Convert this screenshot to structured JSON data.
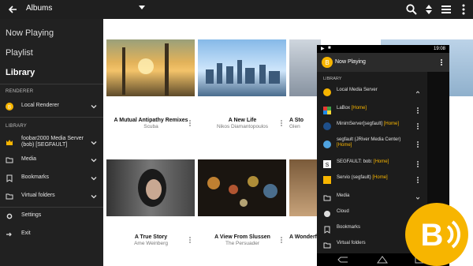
{
  "appbar": {
    "title": "Albums"
  },
  "drawer": {
    "nav": [
      "Now Playing",
      "Playlist",
      "Library"
    ],
    "renderer_section": "RENDERER",
    "renderer": "Local Renderer",
    "library_section": "LIBRARY",
    "library_items": [
      {
        "label1": "foobar2000 Media Server",
        "label2": "(bob) [SEGFAULT]"
      },
      {
        "label1": "Media",
        "label2": ""
      },
      {
        "label1": "Bookmarks",
        "label2": ""
      },
      {
        "label1": "Virtual folders",
        "label2": ""
      }
    ],
    "settings": "Settings",
    "exit": "Exit"
  },
  "albums": [
    {
      "title": "A Mutual Antipathy Remixes",
      "artist": "Scuba"
    },
    {
      "title": "A New Life",
      "artist": "Nikos Diamantopoulos"
    },
    {
      "title": "A Sto",
      "artist": "Glen"
    },
    {
      "title": "A True Story",
      "artist": "Ame Weinberg"
    },
    {
      "title": "A View From Slussen",
      "artist": "The Persuader"
    },
    {
      "title": "A Wonderfu",
      "artist": ""
    }
  ],
  "phone": {
    "time": "19:08",
    "title": "Now Playing",
    "library_section": "LIBRARY",
    "local_server": "Local Media Server",
    "servers": [
      {
        "name": "LaBox ",
        "tag": "[Home]"
      },
      {
        "name": "MinimServer[segfault] ",
        "tag": "[Home]"
      },
      {
        "name": "segfault (JRiver Media Center) ",
        "tag": "[Home]"
      },
      {
        "name": "SEGFAULT: bob: ",
        "tag": "[Home]"
      },
      {
        "name": "Servio (segfault) ",
        "tag": "[Home]"
      }
    ],
    "media": "Media",
    "cloud": "Cloud",
    "bookmarks": "Bookmarks",
    "virtual_folders": "Virtual folders"
  },
  "colors": {
    "accent": "#f7b500",
    "appbar": "#1f1f1f",
    "drawer": "#212121"
  }
}
